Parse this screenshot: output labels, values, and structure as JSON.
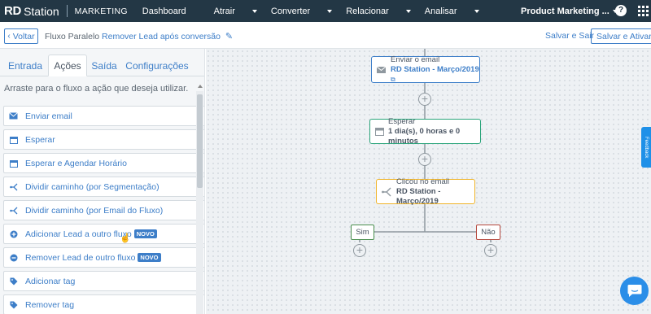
{
  "topbar": {
    "logo_bold": "RD",
    "logo_text": "Station",
    "product": "MARKETING",
    "nav": [
      {
        "label": "Dashboard",
        "has_caret": false
      },
      {
        "label": "Atrair",
        "has_caret": true
      },
      {
        "label": "Converter",
        "has_caret": true
      },
      {
        "label": "Relacionar",
        "has_caret": true
      },
      {
        "label": "Analisar",
        "has_caret": true
      }
    ],
    "account": "Product Marketing ...",
    "help_glyph": "?"
  },
  "subbar": {
    "back_label": "Voltar",
    "crumb_flow": "Fluxo Paralelo",
    "crumb_name": "Remover Lead após conversão",
    "save_exit": "Salvar e Sair",
    "save_activate": "Salvar e Ativar"
  },
  "left_panel": {
    "tabs": [
      {
        "label": "Entrada"
      },
      {
        "label": "Ações",
        "active": true
      },
      {
        "label": "Saída"
      },
      {
        "label": "Configurações"
      }
    ],
    "instruction": "Arraste para o fluxo a ação que deseja utilizar.",
    "actions": [
      {
        "label": "Enviar email",
        "icon": "envelope-icon"
      },
      {
        "label": "Esperar",
        "icon": "calendar-icon"
      },
      {
        "label": "Esperar e Agendar Horário",
        "icon": "calendar-icon"
      },
      {
        "label": "Dividir caminho (por Segmentação)",
        "icon": "split-icon"
      },
      {
        "label": "Dividir caminho (por Email do Fluxo)",
        "icon": "split-icon"
      },
      {
        "label": "Adicionar Lead a outro fluxo",
        "icon": "plus-circle-icon",
        "badge": "NOVO"
      },
      {
        "label": "Remover Lead de outro fluxo",
        "icon": "minus-circle-icon",
        "badge": "NOVO"
      },
      {
        "label": "Adicionar tag",
        "icon": "tag-icon"
      },
      {
        "label": "Remover tag",
        "icon": "tag-icon"
      }
    ]
  },
  "flow": {
    "email_node": {
      "line1": "Enviar o email",
      "line2": "RD Station - Março/2019",
      "color": "#3d7ec8"
    },
    "wait_node": {
      "line1": "Esperar",
      "line2": "1 dia(s), 0 horas e 0 minutos",
      "color": "#2aa47a"
    },
    "condition_node": {
      "line1": "Clicou no email",
      "line2": "RD Station - Março/2019",
      "color": "#f0b429"
    },
    "yes_label": "Sim",
    "yes_color": "#4a8f4e",
    "no_label": "Não",
    "no_color": "#b5473c"
  },
  "widgets": {
    "feedback": "Feedback"
  }
}
